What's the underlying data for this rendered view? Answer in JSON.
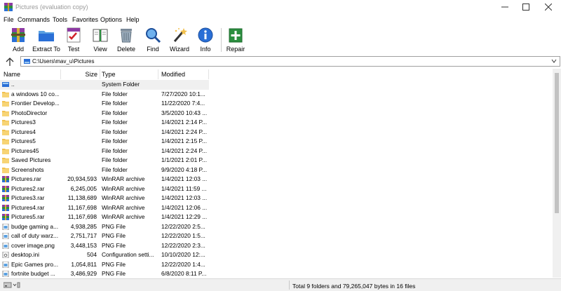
{
  "window": {
    "title": "Pictures (evaluation copy)"
  },
  "menu": [
    "File",
    "Commands",
    "Tools",
    "Favorites",
    "Options",
    "Help"
  ],
  "toolbar": [
    {
      "label": "Add",
      "icon": "add-archive-icon"
    },
    {
      "label": "Extract To",
      "icon": "extract-folder-icon"
    },
    {
      "label": "Test",
      "icon": "test-checklist-icon"
    },
    {
      "label": "View",
      "icon": "view-book-icon"
    },
    {
      "label": "Delete",
      "icon": "trash-icon"
    },
    {
      "label": "Find",
      "icon": "magnifier-icon"
    },
    {
      "label": "Wizard",
      "icon": "magic-wand-icon"
    },
    {
      "label": "Info",
      "icon": "info-icon"
    },
    {
      "label": "Repair",
      "icon": "repair-kit-icon"
    }
  ],
  "address": {
    "path": "C:\\Users\\mav_u\\Pictures"
  },
  "columns": {
    "name": "Name",
    "size": "Size",
    "type": "Type",
    "modified": "Modified"
  },
  "rows": [
    {
      "name": "..",
      "size": "",
      "type": "System Folder",
      "modified": "",
      "kind": "up"
    },
    {
      "name": "a windows 10 co...",
      "size": "",
      "type": "File folder",
      "modified": "7/27/2020 10:1...",
      "kind": "folder"
    },
    {
      "name": "Frontier Develop...",
      "size": "",
      "type": "File folder",
      "modified": "11/22/2020 7:4...",
      "kind": "folder"
    },
    {
      "name": "PhotoDirector",
      "size": "",
      "type": "File folder",
      "modified": "3/5/2020 10:43 ...",
      "kind": "folder"
    },
    {
      "name": "Pictures3",
      "size": "",
      "type": "File folder",
      "modified": "1/4/2021 2:14 P...",
      "kind": "folder"
    },
    {
      "name": "Pictures4",
      "size": "",
      "type": "File folder",
      "modified": "1/4/2021 2:24 P...",
      "kind": "folder"
    },
    {
      "name": "Pictures5",
      "size": "",
      "type": "File folder",
      "modified": "1/4/2021 2:15 P...",
      "kind": "folder"
    },
    {
      "name": "Pictures45",
      "size": "",
      "type": "File folder",
      "modified": "1/4/2021 2:24 P...",
      "kind": "folder"
    },
    {
      "name": "Saved Pictures",
      "size": "",
      "type": "File folder",
      "modified": "1/1/2021 2:01 P...",
      "kind": "folder"
    },
    {
      "name": "Screenshots",
      "size": "",
      "type": "File folder",
      "modified": "9/9/2020 4:18 P...",
      "kind": "folder"
    },
    {
      "name": "Pictures.rar",
      "size": "20,934,593",
      "type": "WinRAR archive",
      "modified": "1/4/2021 12:03 ...",
      "kind": "rar"
    },
    {
      "name": "Pictures2.rar",
      "size": "6,245,005",
      "type": "WinRAR archive",
      "modified": "1/4/2021 11:59 ...",
      "kind": "rar"
    },
    {
      "name": "Pictures3.rar",
      "size": "11,138,689",
      "type": "WinRAR archive",
      "modified": "1/4/2021 12:03 ...",
      "kind": "rar"
    },
    {
      "name": "Pictures4.rar",
      "size": "11,167,698",
      "type": "WinRAR archive",
      "modified": "1/4/2021 12:06 ...",
      "kind": "rar"
    },
    {
      "name": "Pictures5.rar",
      "size": "11,167,698",
      "type": "WinRAR archive",
      "modified": "1/4/2021 12:29 ...",
      "kind": "rar"
    },
    {
      "name": "budge gaming a...",
      "size": "4,938,285",
      "type": "PNG File",
      "modified": "12/22/2020 2:5...",
      "kind": "png"
    },
    {
      "name": "call of duty warz...",
      "size": "2,751,717",
      "type": "PNG File",
      "modified": "12/22/2020 1:5...",
      "kind": "png"
    },
    {
      "name": "cover image.png",
      "size": "3,448,153",
      "type": "PNG File",
      "modified": "12/22/2020 2:3...",
      "kind": "png"
    },
    {
      "name": "desktop.ini",
      "size": "504",
      "type": "Configuration setti...",
      "modified": "10/10/2020 12:...",
      "kind": "ini"
    },
    {
      "name": "Epic Games pro...",
      "size": "1,054,811",
      "type": "PNG File",
      "modified": "12/22/2020 1:4...",
      "kind": "png"
    },
    {
      "name": "fortnite budget ...",
      "size": "3,486,929",
      "type": "PNG File",
      "modified": "6/8/2020 8:11 P...",
      "kind": "png"
    }
  ],
  "status": {
    "summary": "Total 9 folders and 79,265,047 bytes in 16 files"
  },
  "colors": {
    "folder": "#f2c14e",
    "accent": "#2a6fd6"
  }
}
